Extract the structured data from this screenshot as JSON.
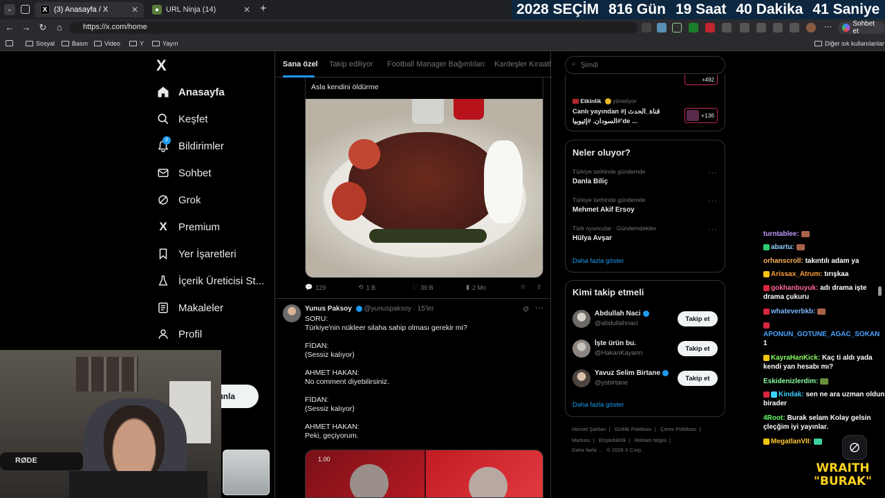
{
  "browser": {
    "tabs": [
      {
        "title": "(3) Anasayfa / X",
        "active": true
      },
      {
        "title": "URL Ninja (14)",
        "active": false
      }
    ],
    "new_tab": "+",
    "url": "https://x.com/home",
    "chat_button": "Sohbet et",
    "bookmarks": [
      "Sosyal",
      "Basın",
      "Video",
      "Y",
      "Yayın"
    ],
    "other_bookmarks": "Diğer sık kullanılanlar"
  },
  "countdown": {
    "year_label": "2028 SEÇİM",
    "days": "816 Gün",
    "hours": "19 Saat",
    "minutes": "40 Dakika",
    "seconds": "41 Saniye"
  },
  "sidebar": {
    "logo": "X",
    "items": [
      {
        "label": "Anasayfa",
        "icon": "home-icon"
      },
      {
        "label": "Keşfet",
        "icon": "search-icon"
      },
      {
        "label": "Bildirimler",
        "icon": "bell-icon",
        "badge": "3"
      },
      {
        "label": "Sohbet",
        "icon": "mail-icon"
      },
      {
        "label": "Grok",
        "icon": "grok-icon"
      },
      {
        "label": "Premium",
        "icon": "x-logo-icon"
      },
      {
        "label": "Yer İşaretleri",
        "icon": "bookmark-icon"
      },
      {
        "label": "İçerik Üreticisi St...",
        "icon": "flask-icon"
      },
      {
        "label": "Makaleler",
        "icon": "article-icon"
      },
      {
        "label": "Profil",
        "icon": "person-icon"
      }
    ],
    "post_button_partial": "ınla"
  },
  "feed": {
    "tabs": [
      "Sana özel",
      "Takip ediliyor",
      "Football Manager Bağımlıları",
      "Kardeşler Kıraath"
    ],
    "quoted_text": "Asla kendini öldürme",
    "tweet1_actions": {
      "replies": "129",
      "reposts": "1 B",
      "likes": "39 B",
      "views": "2 Mn"
    },
    "tweet2": {
      "name": "Yunus Paksoy",
      "handle": "@yunuspaksoy",
      "time": "· 15'ler",
      "body": "SORU:\nTürkiye'nin nükleer silaha sahip olması gerekir mi?\n\nFİDAN:\n(Sessiz kalıyor)\n\nAHMET HAKAN:\nNo comment diyebilirsiniz.\n\nFİDAN:\n(Sessiz kalıyor)\n\nAHMET HAKAN:\nPeki, geçiyorum.",
      "media_timestamp": "1.00"
    }
  },
  "right": {
    "search_placeholder": "Şimdi",
    "event": {
      "top_count": "+492",
      "label": "Etkinlik",
      "role": "yönetiyor",
      "text_line1": "Canlı yayından #| قناة_الحدث",
      "text_line2": "السودان. #إثيوبيا#'de ...",
      "count": "+136"
    },
    "whats_happening": {
      "title": "Neler oluyor?",
      "trends": [
        {
          "context": "Türkiye tarihinde gündemde",
          "name": "Danla Biliç"
        },
        {
          "context": "Türkiye tarihinde gündemde",
          "name": "Mehmet Akif Ersoy"
        },
        {
          "context": "Türk oyuncular · Gündemdekiler",
          "name": "Hülya Avşar"
        }
      ],
      "more": "Daha fazla göster"
    },
    "who_to_follow": {
      "title": "Kimi takip etmeli",
      "users": [
        {
          "name": "Abdullah Naci",
          "handle": "@abdullahnaci",
          "verified": true,
          "button": "Takip et"
        },
        {
          "name": "İşte ürün bu.",
          "handle": "@HakanKayann",
          "verified": false,
          "button": "Takip et"
        },
        {
          "name": "Yavuz Selim Birtane",
          "handle": "@ysbirtane",
          "verified": true,
          "button": "Takip et"
        }
      ],
      "more": "Daha fazla göster"
    },
    "footer": {
      "line1": [
        "Hizmet Şartları",
        "Gizlilik Politikası",
        "Çerez Politikası"
      ],
      "line2": [
        "Markası",
        "Erişilebilirlik",
        "Reklam bilgisi"
      ],
      "line3": "Daha fazla ...   © 2026 X Corp."
    }
  },
  "chat": [
    {
      "user": "turntablee:",
      "color": "#c59bff",
      "msg": ""
    },
    {
      "user": "abartu:",
      "color": "#8fd0ff",
      "msg": ""
    },
    {
      "user": "orhanscroll:",
      "color": "#ffb35c",
      "msg": "takıntılı adam ya"
    },
    {
      "user": "Arissax_Atrum:",
      "color": "#ff9f3a",
      "msg": "tırışkaa"
    },
    {
      "user": "gokhanbuyuk:",
      "color": "#ff6a9a",
      "msg": "adı drama işte drama çukuru"
    },
    {
      "user": "whateverbkb:",
      "color": "#7ab8ff",
      "msg": ""
    },
    {
      "user": "APONUN_GOTUNE_AGAC_SOKAN",
      "color": "#4aa3ff",
      "msg": "1"
    },
    {
      "user": "KayraHanKick:",
      "color": "#8cff66",
      "msg": "Kaç ti aldı yada kendi yan hesabı mı?"
    },
    {
      "user": "Eskidenizlerdim:",
      "color": "#8cff9f",
      "msg": ""
    },
    {
      "user": "Kindak:",
      "color": "#3ad0ff",
      "msg": "sen ne ara uzman oldun birader"
    },
    {
      "user": "4Root:",
      "color": "#66ff66",
      "msg": "Burak selam Kolay gelsin çleçğim iyi yayınlar."
    },
    {
      "user": "MegatlanVII:",
      "color": "#ffcc33",
      "msg": ""
    }
  ],
  "overlay": {
    "logo_line1": "WRAITH",
    "logo_line2": "\"BURAK\""
  }
}
